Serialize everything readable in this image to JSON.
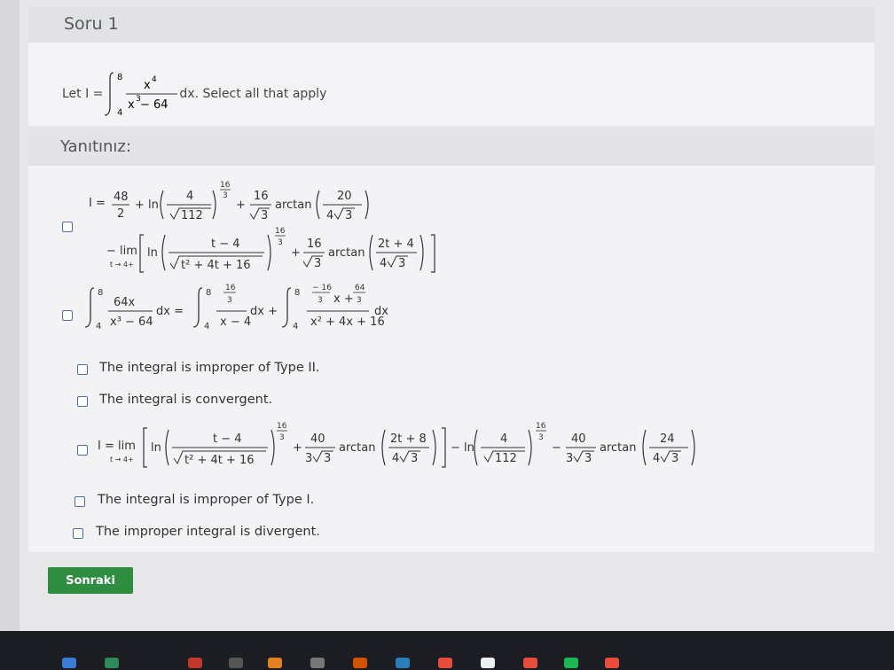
{
  "question": {
    "title": "Soru 1",
    "prompt_lead": "Let I =",
    "prompt_tail": "dx. Select all that apply",
    "integral": {
      "lower": "4",
      "upper": "8",
      "num": "x",
      "num_exp": "4",
      "den": "x",
      "den_exp": "3",
      "den_rest": " − 64"
    }
  },
  "answers": {
    "header": "Yanıtınız:",
    "options": [
      {
        "id": "opt1",
        "kind": "formula"
      },
      {
        "id": "opt2",
        "kind": "formula"
      },
      {
        "id": "opt3",
        "kind": "text",
        "label": "The integral is improper of Type II."
      },
      {
        "id": "opt4",
        "kind": "text",
        "label": "The integral is convergent."
      },
      {
        "id": "opt5",
        "kind": "formula"
      },
      {
        "id": "opt6",
        "kind": "text",
        "label": "The integral is improper of Type I."
      },
      {
        "id": "opt7",
        "kind": "text",
        "label": "The improper integral is divergent."
      }
    ]
  },
  "next_button": "Sonraki",
  "colors": {
    "accent": "#2f8d3f",
    "checkbox": "#4a6fa8"
  }
}
